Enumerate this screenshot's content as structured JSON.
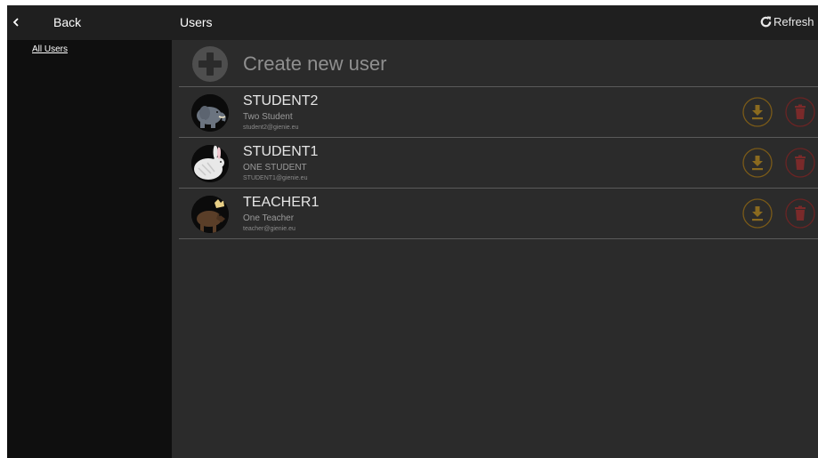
{
  "header": {
    "back_label": "Back",
    "title": "Users",
    "refresh_label": "Refresh"
  },
  "sidebar": {
    "items": [
      {
        "label": "All Users"
      }
    ]
  },
  "main": {
    "create_label": "Create new user",
    "users": [
      {
        "username": "STUDENT2",
        "full_name": "Two Student",
        "email": "student2@gienie.eu",
        "avatar": "elephant"
      },
      {
        "username": "STUDENT1",
        "full_name": "ONE STUDENT",
        "email": "STUDENT1@gienie.eu",
        "avatar": "rabbit"
      },
      {
        "username": "TEACHER1",
        "full_name": "One Teacher",
        "email": "teacher@gienie.eu",
        "avatar": "moose"
      }
    ]
  },
  "icons": {
    "back": "chevron-left-icon",
    "refresh": "refresh-icon",
    "create": "plus-circle-icon",
    "download": "download-icon",
    "delete": "trash-icon"
  },
  "colors": {
    "background": "#2b2b2b",
    "topbar": "#1f1f1f",
    "sidebar": "#0f0f0f",
    "download_accent": "#8a6a1f",
    "delete_accent": "#7a2a2a"
  }
}
